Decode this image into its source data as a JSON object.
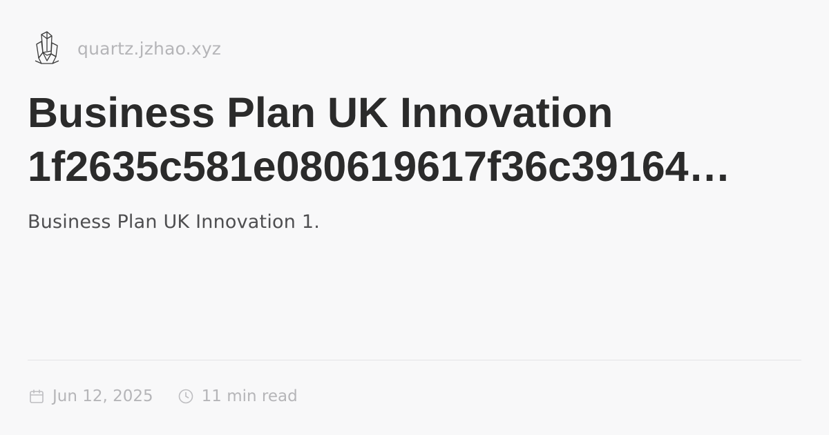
{
  "site": {
    "logo_icon": "crystal-icon",
    "url": "quartz.jzhao.xyz"
  },
  "page": {
    "title_line1": "Business Plan UK Innovation",
    "title_line2": "1f2635c581e080619617f36c39164…",
    "description": "Business Plan UK Innovation 1."
  },
  "meta": {
    "date_icon": "calendar-icon",
    "date": "Jun 12, 2025",
    "read_icon": "clock-icon",
    "reading_time": "11 min read"
  },
  "colors": {
    "background": "#f8f8f9",
    "title": "#2b2b2b",
    "muted": "#b5b5b8",
    "body_text": "#4e4e50"
  }
}
